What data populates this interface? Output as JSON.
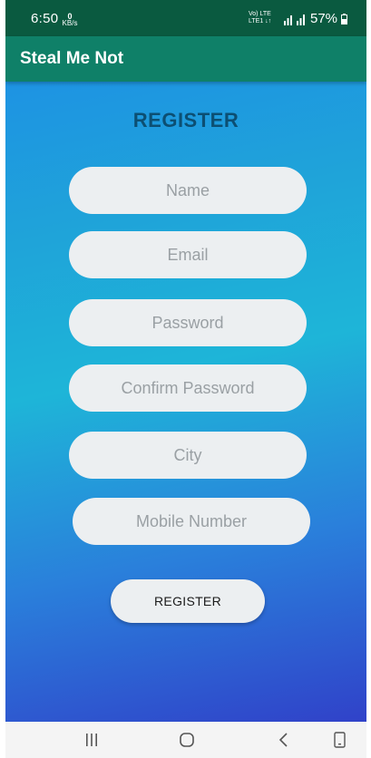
{
  "status_bar": {
    "time": "6:50",
    "speed_value": "0",
    "speed_unit": "KB/s",
    "network_top": "Vo) LTE",
    "network_bottom": "LTE1 ↓↑",
    "battery": "57%"
  },
  "app_bar": {
    "title": "Steal Me Not"
  },
  "form": {
    "heading": "REGISTER",
    "fields": [
      {
        "placeholder": "Name",
        "value": ""
      },
      {
        "placeholder": "Email",
        "value": ""
      },
      {
        "placeholder": "Password",
        "value": ""
      },
      {
        "placeholder": "Confirm Password",
        "value": ""
      },
      {
        "placeholder": "City",
        "value": ""
      },
      {
        "placeholder": "Mobile Number",
        "value": ""
      }
    ],
    "submit_label": "REGISTER"
  },
  "nav_bar": {
    "icons": [
      "recents-icon",
      "home-icon",
      "back-icon",
      "rotate-icon"
    ]
  },
  "colors": {
    "status_bar": "#0a5a40",
    "app_bar": "#0f8068",
    "heading": "#0c4f73",
    "field_bg": "#eceff1",
    "gradient_top": "#1e93e3",
    "gradient_bottom": "#3042c9"
  }
}
